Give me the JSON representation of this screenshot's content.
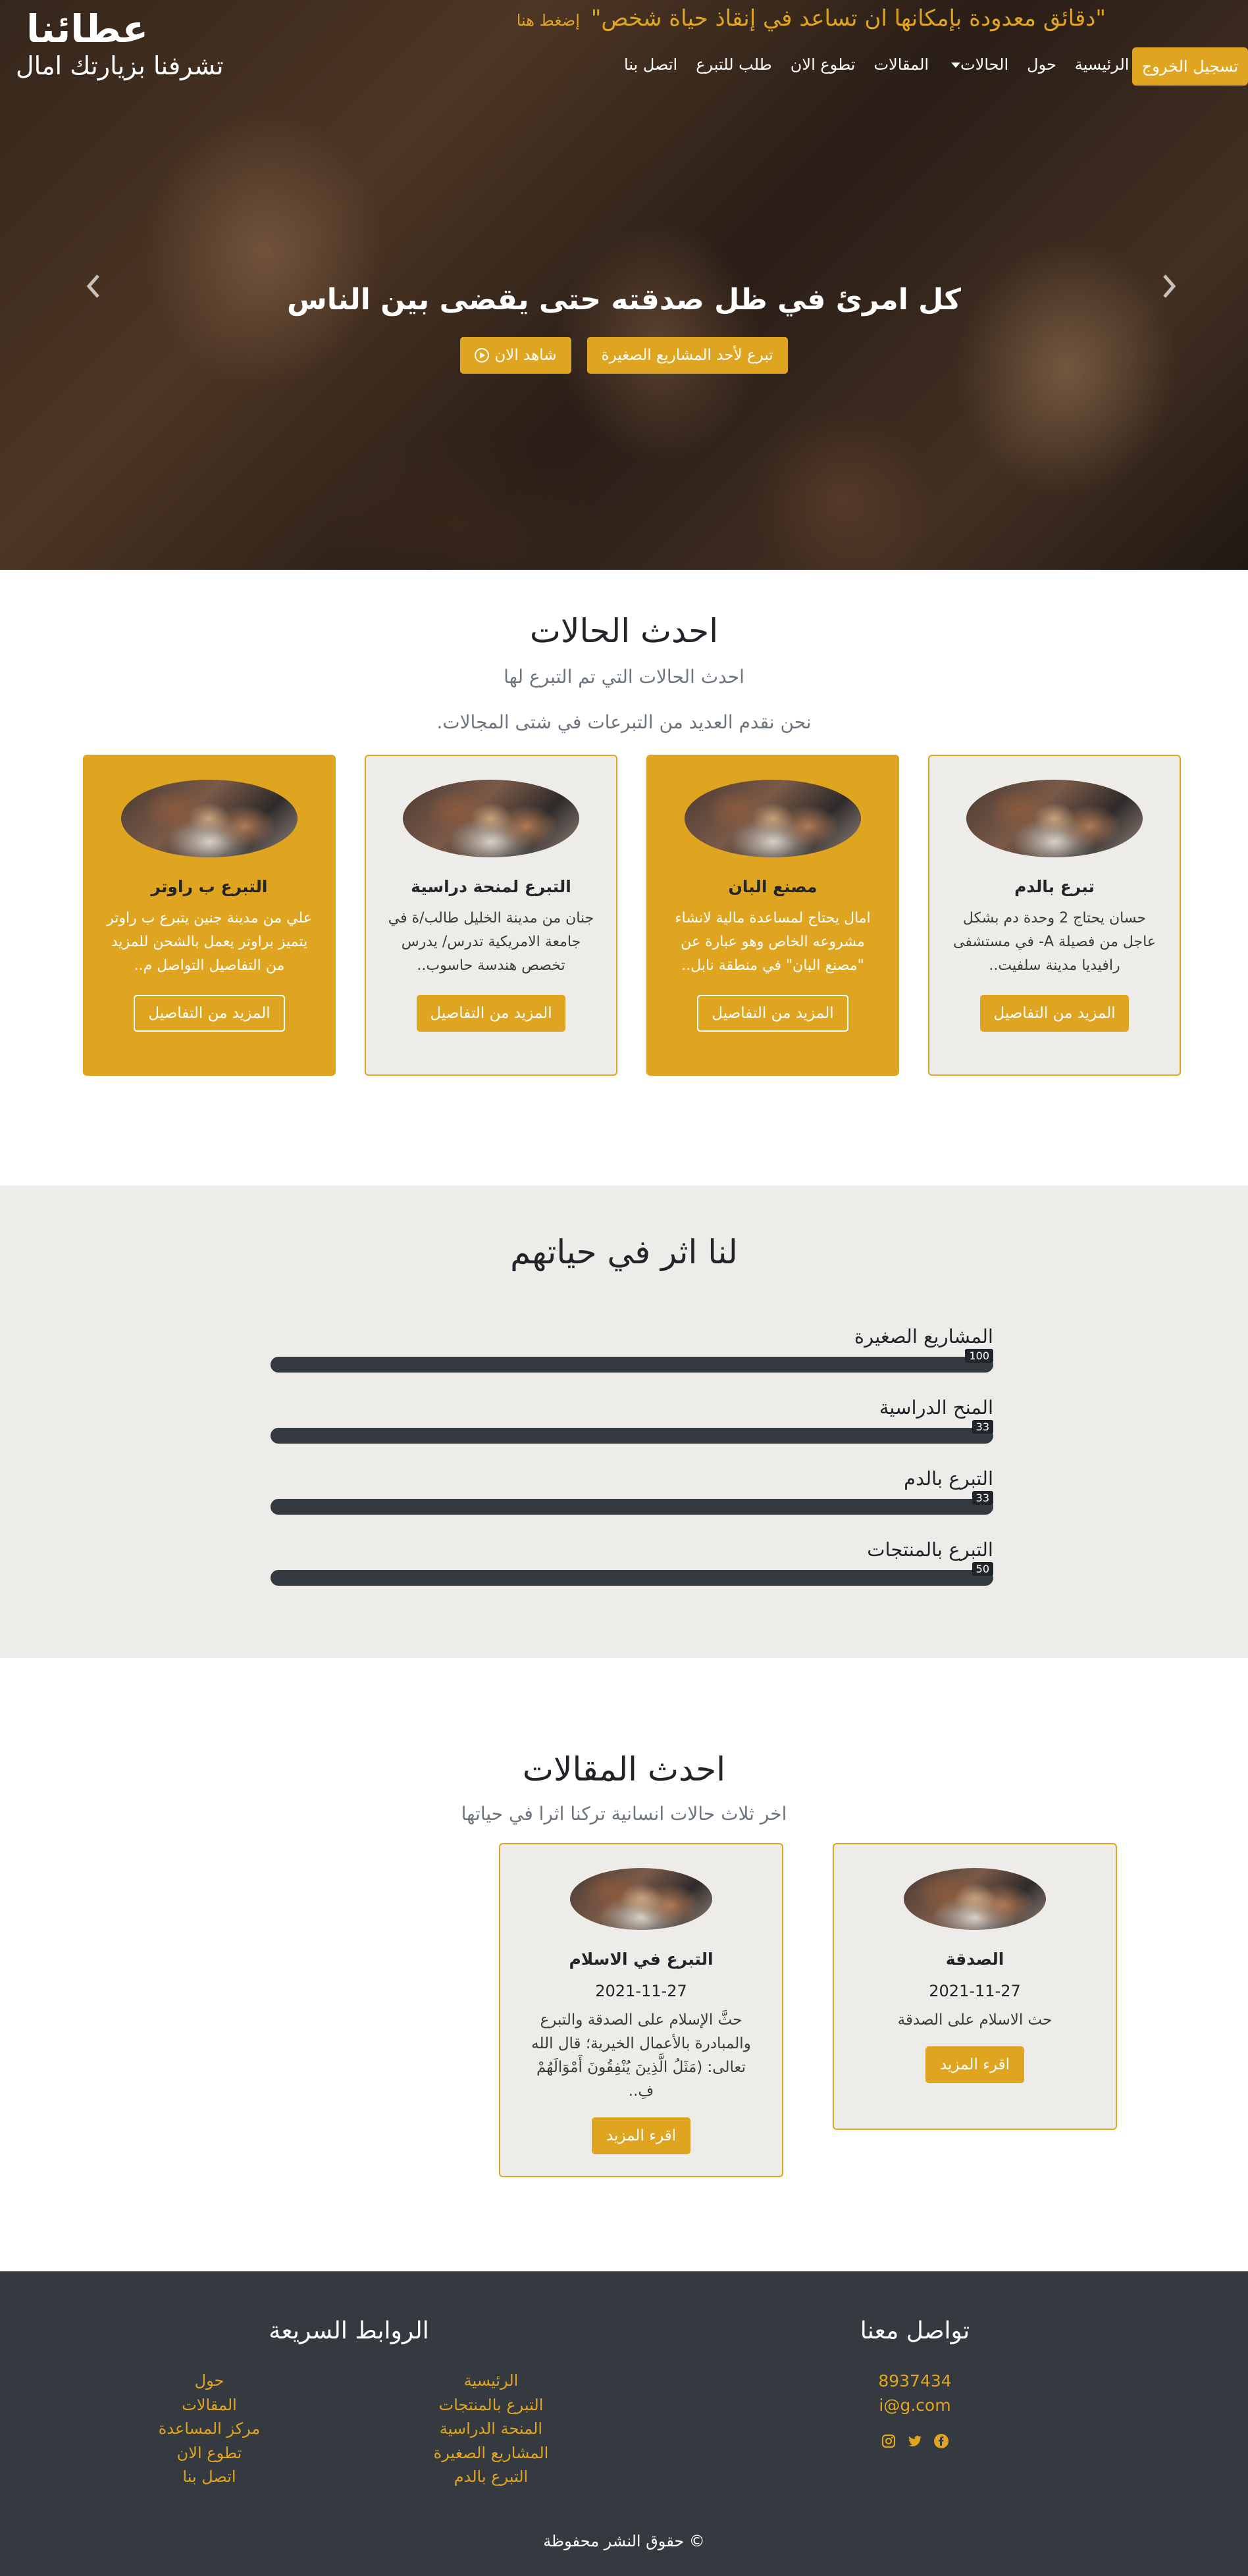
{
  "brand": {
    "logo": "عطائنا",
    "welcome": "تشرفنا بزيارتك امال"
  },
  "tagline": {
    "text": "\"دقائق معدودة بإمكانها ان تساعد في إنقاذ حياة شخص\"",
    "click": "إضغط هنا"
  },
  "nav": {
    "items": [
      "الرئيسية",
      "حول",
      "الحالات",
      "المقالات",
      "تطوع الان",
      "طلب للتبرع",
      "اتصل بنا"
    ],
    "logout": "تسجيل الخروج"
  },
  "hero": {
    "title": "كل امرئ في ظل صدقته حتى يقضى بين الناس",
    "donate_btn": "تبرع لأحد المشاريع الصغيرة",
    "watch_btn": "شاهد الان"
  },
  "cases": {
    "title": "احدث الحالات",
    "subtitle": "احدث الحالات التي تم التبرع لها",
    "desc": "نحن نقدم العديد من التبرعات في شتى المجالات.",
    "cards": [
      {
        "title": "تبرع بالدم",
        "text": "حسان يحتاج 2 وحدة دم بشكل عاجل من فصيلة A- في مستشفى رافيديا مدينة سلفيت..",
        "button": "المزيد من التفاصيل"
      },
      {
        "title": "مصنع البان",
        "text": "امال يحتاج لمساعدة مالية لانشاء مشروعه الخاص وهو عبارة عن \"مصنع البان\" في منطقة نابل..",
        "button": "المزيد من التفاصيل"
      },
      {
        "title": "التبرع لمنحة دراسية",
        "text": "جنان من مدينة الخليل طالب/ة في جامعة الامريكية تدرس/ يدرس تخصص هندسة حاسوب..",
        "button": "المزيد من التفاصيل"
      },
      {
        "title": "التبرع ب راوتر",
        "text": "علي من مدينة جنين يتبرع ب راوتر يتميز براوتر يعمل بالشحن للمزيد من التفاصيل التواصل م..",
        "button": "المزيد من التفاصيل"
      }
    ]
  },
  "impact": {
    "title": "لنا اثر في حياتهم",
    "bars": [
      {
        "label": "المشاريع الصغيرة",
        "value": "100"
      },
      {
        "label": "المنح الدراسية",
        "value": "33"
      },
      {
        "label": "التبرع بالدم",
        "value": "33"
      },
      {
        "label": "التبرع بالمنتجات",
        "value": "50"
      }
    ]
  },
  "articles": {
    "title": "احدث المقالات",
    "subtitle": "اخر ثلاث حالات انسانية تركنا اثرا في حياتها",
    "items": [
      {
        "title": "الصدقة",
        "date": "2021-11-27",
        "text": "حث الاسلام على الصدقة",
        "button": "اقرء المزيد"
      },
      {
        "title": "التبرع في الاسلام",
        "date": "2021-11-27",
        "text": "حثَّ الإسلام على الصدقة والتبرع والمبادرة بالأعمال الخيرية؛ قال الله تعالى: (مَثَلُ الَّذِينَ يُنْفِقُونَ أَمْوَالَهُمْ فِ..",
        "button": "اقرء المزيد"
      }
    ]
  },
  "footer": {
    "contact_title": "تواصل معنا",
    "phone": "8937434",
    "email": "i@g.com",
    "links_title": "الروابط السريعة",
    "links_col1": [
      "الرئيسية",
      "التبرع بالمنتجات",
      "المنحة الدراسية",
      "المشاريع الصغيرة",
      "التبرع بالدم"
    ],
    "links_col2": [
      "حول",
      "المقالات",
      "مركز المساعدة",
      "تطوع الان",
      "اتصل بنا"
    ],
    "copyright": "© حقوق النشر محفوظة"
  },
  "icons": [
    "chevron-left-icon",
    "chevron-right-icon",
    "play-circle-icon",
    "caret-down-icon",
    "facebook-icon",
    "twitter-icon",
    "instagram-icon"
  ],
  "colors": {
    "accent": "#e0a520",
    "footer_bg": "#343a40",
    "section_bg": "#eeece8"
  }
}
